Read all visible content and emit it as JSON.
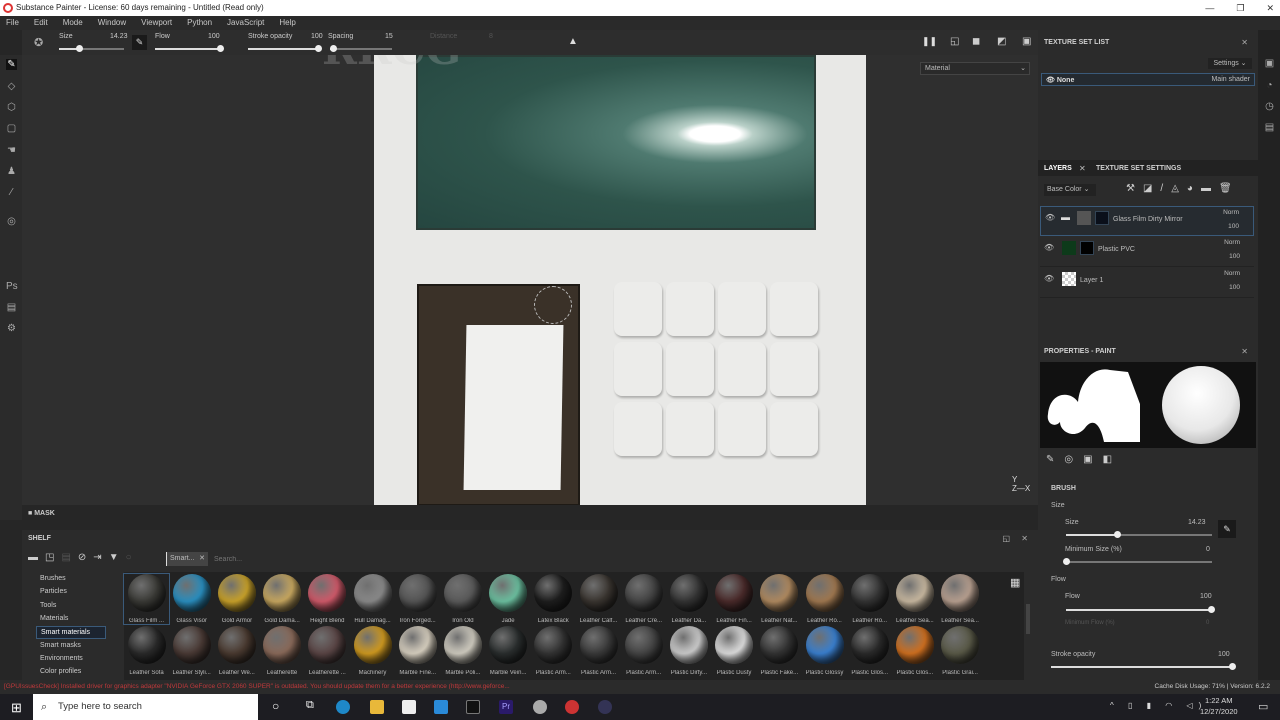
{
  "window": {
    "title": "Substance Painter - License: 60 days remaining - Untitled (Read only)",
    "min": "—",
    "max": "❐",
    "close": "✕"
  },
  "menu": [
    "File",
    "Edit",
    "Mode",
    "Window",
    "Viewport",
    "Python",
    "JavaScript",
    "Help"
  ],
  "toolbar": {
    "size_label": "Size",
    "size_value": "14.23",
    "size_pct": 0.3,
    "flow_label": "Flow",
    "flow_value": "100",
    "flow_pct": 1,
    "opacity_label": "Stroke opacity",
    "opacity_value": "100",
    "opacity_pct": 1,
    "spacing_label": "Spacing",
    "spacing_value": "15",
    "spacing_pct": 0.05,
    "distance_label": "Distance",
    "distance_value": "8"
  },
  "viewport": {
    "material_select": "Material",
    "axis": "Y\nZ—X",
    "watermark": "RRCG"
  },
  "texture_set_list": {
    "title": "TEXTURE SET LIST",
    "settings": "Settings ⌄",
    "row_name": "None",
    "row_shader": "Main shader"
  },
  "layers": {
    "tab_layers": "LAYERS",
    "tab_tss": "TEXTURE SET SETTINGS",
    "channel": "Base Color ⌄",
    "items": [
      {
        "name": "Glass Film Dirty Mirror",
        "blend": "Norm",
        "opacity": "100"
      },
      {
        "name": "Plastic PVC",
        "blend": "Norm",
        "opacity": "100"
      },
      {
        "name": "Layer 1",
        "blend": "Norm",
        "opacity": "100"
      }
    ]
  },
  "properties": {
    "title": "PROPERTIES - PAINT",
    "brush": "BRUSH",
    "size_group": "Size",
    "size_label": "Size",
    "size_value": "14.23",
    "size_pct": 0.35,
    "min_size_label": "Minimum Size (%)",
    "min_size_value": "0",
    "flow_group": "Flow",
    "flow_label": "Flow",
    "flow_value": "100",
    "min_flow_label": "Minimum Flow (%)",
    "min_flow_value": "0",
    "opacity_label": "Stroke opacity",
    "opacity_value": "100"
  },
  "mask": {
    "label": "MASK"
  },
  "shelf": {
    "title": "SHELF",
    "filter_tag": "Smart...",
    "search_placeholder": "Search...",
    "categories": [
      "Brushes",
      "Particles",
      "Tools",
      "Materials",
      "Smart materials",
      "Smart masks",
      "Environments",
      "Color profiles"
    ],
    "selected_category": "Smart materials",
    "materials": [
      [
        "Glass Film ...",
        "#3a3a36"
      ],
      [
        "Glass Visor",
        "#2a8fc0"
      ],
      [
        "Gold Armor",
        "#c9a22a"
      ],
      [
        "Gold Dama...",
        "#c8a860"
      ],
      [
        "Height Blend",
        "#d05a6a"
      ],
      [
        "Hull Damag...",
        "#8a8a8a"
      ],
      [
        "Iron Forged...",
        "#555"
      ],
      [
        "Iron Old",
        "#5a5a5a"
      ],
      [
        "Jade",
        "#6cc0a0"
      ],
      [
        "Latex Black",
        "#1e1e1e"
      ],
      [
        "Leather Calf...",
        "#3a3530"
      ],
      [
        "Leather Cre...",
        "#444"
      ],
      [
        "Leather Da...",
        "#333"
      ],
      [
        "Leather Fin...",
        "#4a2a2a"
      ],
      [
        "Leather Nat...",
        "#b08a60"
      ],
      [
        "Leather Ro...",
        "#a07850"
      ],
      [
        "Leather Ro...",
        "#333"
      ],
      [
        "Leather Sea...",
        "#c8b8a0"
      ],
      [
        "Leather Sea...",
        "#b8a090"
      ],
      [
        "Leather Sofa",
        "#2a2a2a"
      ],
      [
        "Leather Styli...",
        "#4a3a35"
      ],
      [
        "Leather We...",
        "#4a3a30"
      ],
      [
        "Leatherette",
        "#8a6a5a"
      ],
      [
        "Leatherette ...",
        "#5a4545"
      ],
      [
        "Machinery",
        "#d09a20"
      ],
      [
        "Marble Fine...",
        "#d8d0c0"
      ],
      [
        "Marble Poli...",
        "#d0ccc0"
      ],
      [
        "Marble Vein...",
        "#2a2e2e"
      ],
      [
        "Plastic Arm...",
        "#333"
      ],
      [
        "Plastic Arm...",
        "#3a3a3a"
      ],
      [
        "Plastic Arm...",
        "#444"
      ],
      [
        "Plastic Dirty...",
        "#ccc"
      ],
      [
        "Plastic Dusty",
        "#ddd"
      ],
      [
        "Plastic Fake...",
        "#333"
      ],
      [
        "Plastic Glossy",
        "#3a80d0"
      ],
      [
        "Plastic Glos...",
        "#2a2a2a"
      ],
      [
        "Plastic Glos...",
        "#d07020"
      ],
      [
        "Plastic Grai...",
        "#5a5a48"
      ]
    ]
  },
  "status": {
    "log": "[GPUIssuesCheck] Installed driver for graphics adapter \"NVIDIA GeForce GTX 2060 SUPER\" is outdated. You should update them for a better experience (http://www.geforce...",
    "cache": "Cache Disk Usage:   71% | Version: 6.2.2"
  },
  "taskbar": {
    "search": "Type here to search",
    "time": "1:22 AM",
    "date": "12/27/2020"
  }
}
